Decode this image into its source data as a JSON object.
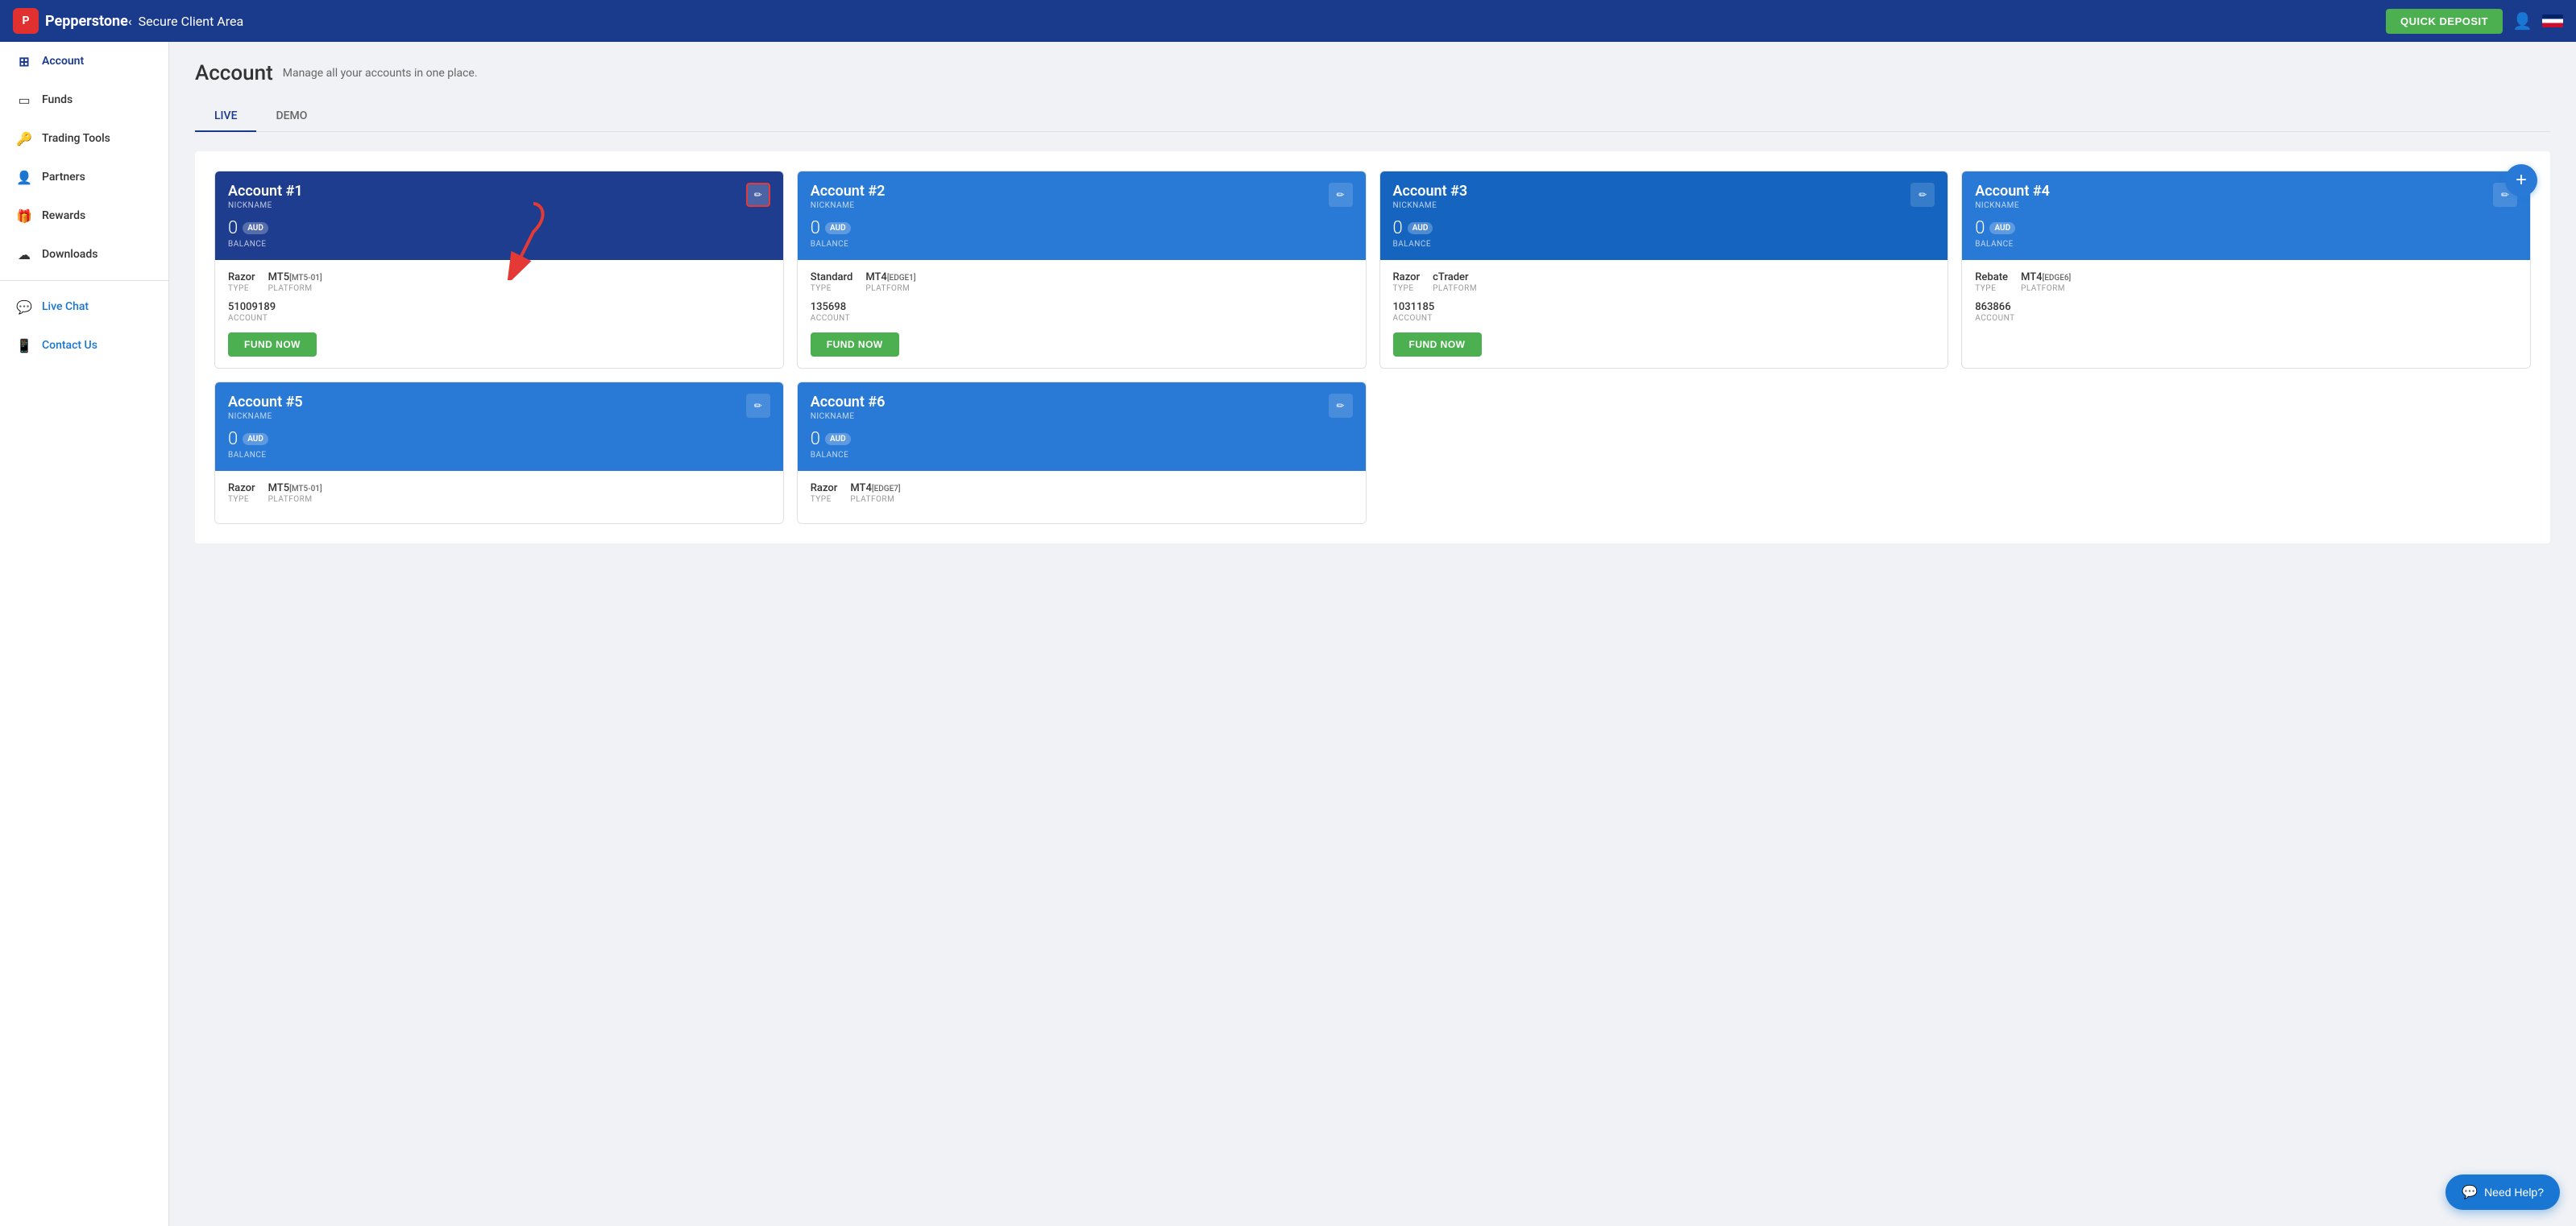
{
  "topnav": {
    "logo_text": "Pepperstone",
    "logo_letter": "P",
    "back_arrow": "‹",
    "title": "Secure Client Area",
    "quick_deposit_label": "QUICK DEPOSIT"
  },
  "sidebar": {
    "items": [
      {
        "id": "account",
        "label": "Account",
        "icon": "layers"
      },
      {
        "id": "funds",
        "label": "Funds",
        "icon": "wallet"
      },
      {
        "id": "trading-tools",
        "label": "Trading Tools",
        "icon": "key"
      },
      {
        "id": "partners",
        "label": "Partners",
        "icon": "person"
      },
      {
        "id": "rewards",
        "label": "Rewards",
        "icon": "gift"
      },
      {
        "id": "downloads",
        "label": "Downloads",
        "icon": "cloud"
      }
    ],
    "bottom_items": [
      {
        "id": "live-chat",
        "label": "Live Chat",
        "icon": "chat"
      },
      {
        "id": "contact-us",
        "label": "Contact Us",
        "icon": "phone"
      }
    ]
  },
  "page": {
    "title": "Account",
    "subtitle": "Manage all your accounts in one place.",
    "tabs": [
      {
        "id": "live",
        "label": "LIVE",
        "active": true
      },
      {
        "id": "demo",
        "label": "DEMO",
        "active": false
      }
    ]
  },
  "accounts_row1": [
    {
      "id": "acc1",
      "title": "Account #1",
      "nickname_label": "NICKNAME",
      "balance": "0",
      "currency": "AUD",
      "balance_label": "BALANCE",
      "type": "Razor",
      "type_label": "TYPE",
      "platform": "MT5",
      "platform_tag": "[MT5-01]",
      "platform_label": "PLATFORM",
      "account_num": "51009189",
      "account_label": "ACCOUNT",
      "fund_label": "FUND NOW",
      "header_color": "dark-blue",
      "edit_highlighted": true
    },
    {
      "id": "acc2",
      "title": "Account #2",
      "nickname_label": "NICKNAME",
      "balance": "0",
      "currency": "AUD",
      "balance_label": "BALANCE",
      "type": "Standard",
      "type_label": "TYPE",
      "platform": "MT4",
      "platform_tag": "[EDGE1]",
      "platform_label": "PLATFORM",
      "account_num": "135698",
      "account_label": "ACCOUNT",
      "fund_label": "FUND NOW",
      "header_color": "light-blue",
      "edit_highlighted": false
    },
    {
      "id": "acc3",
      "title": "Account #3",
      "nickname_label": "NICKNAME",
      "balance": "0",
      "currency": "AUD",
      "balance_label": "BALANCE",
      "type": "Razor",
      "type_label": "TYPE",
      "platform": "cTrader",
      "platform_tag": "",
      "platform_label": "PLATFORM",
      "account_num": "1031185",
      "account_label": "ACCOUNT",
      "fund_label": "FUND NOW",
      "header_color": "medium-blue",
      "edit_highlighted": false
    },
    {
      "id": "acc4",
      "title": "Account #4",
      "nickname_label": "NICKNAME",
      "balance": "0",
      "currency": "AUD",
      "balance_label": "BALANCE",
      "type": "Rebate",
      "type_label": "TYPE",
      "platform": "MT4",
      "platform_tag": "[EDGE6]",
      "platform_label": "PLATFORM",
      "account_num": "863866",
      "account_label": "ACCOUNT",
      "fund_label": "",
      "header_color": "light-blue",
      "edit_highlighted": false
    }
  ],
  "accounts_row2": [
    {
      "id": "acc5",
      "title": "Account #5",
      "nickname_label": "NICKNAME",
      "balance": "0",
      "currency": "AUD",
      "balance_label": "BALANCE",
      "type": "Razor",
      "type_label": "TYPE",
      "platform": "MT5",
      "platform_tag": "[MT5-01]",
      "platform_label": "PLATFORM",
      "header_color": "light-blue"
    },
    {
      "id": "acc6",
      "title": "Account #6",
      "nickname_label": "NICKNAME",
      "balance": "0",
      "currency": "AUD",
      "balance_label": "BALANCE",
      "type": "Razor",
      "type_label": "TYPE",
      "platform": "MT4",
      "platform_tag": "[EDGE7]",
      "platform_label": "PLATFORM",
      "header_color": "light-blue"
    }
  ],
  "add_button_label": "+",
  "help_button_label": "Need Help?"
}
